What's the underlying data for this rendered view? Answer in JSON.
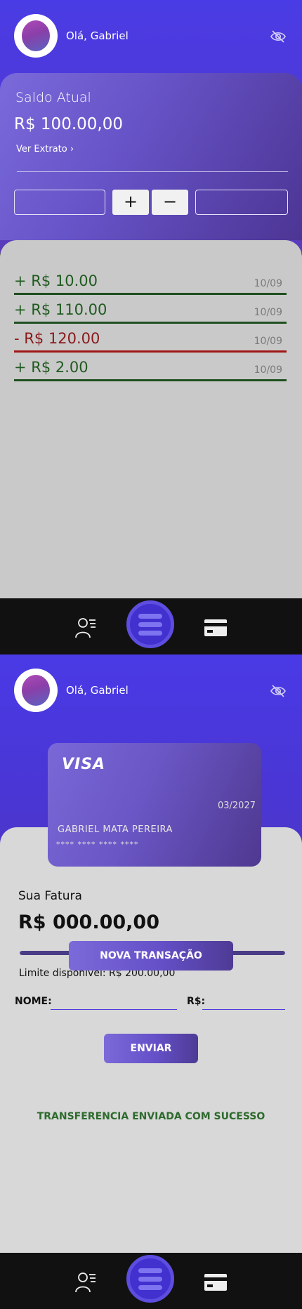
{
  "header": {
    "greeting": "Olá, Gabriel"
  },
  "balance": {
    "label": "Saldo Atual",
    "value": "R$ 100.00,00",
    "statement_link": "Ver Extrato ›",
    "plus_label": "+",
    "minus_label": "−"
  },
  "transactions": [
    {
      "amount": "+ R$ 10.00",
      "date": "10/09",
      "type": "credit"
    },
    {
      "amount": "+ R$ 110.00",
      "date": "10/09",
      "type": "credit"
    },
    {
      "amount": "- R$ 120.00",
      "date": "10/09",
      "type": "debit"
    },
    {
      "amount": "+ R$ 2.00",
      "date": "10/09",
      "type": "credit"
    }
  ],
  "card": {
    "brand": "VISA",
    "expiry": "03/2027",
    "holder": "GABRIEL MATA PEREIRA",
    "number": "**** **** **** ****"
  },
  "invoice": {
    "label": "Sua Fatura",
    "value": "R$ 000.00,00",
    "limit": "Limite disponível: R$ 200.00,00",
    "progress": 1.0
  },
  "transfer": {
    "new_button": "NOVA TRANSAÇÃO",
    "name_label": "NOME:",
    "amount_label": "R$:",
    "send_button": "ENVIAR",
    "status": "TRANSFERENCIA ENVIADA COM SUCESSO"
  },
  "colors": {
    "accent": "#4a3ce4",
    "credit": "#1f5a1f",
    "debit": "#8a1a1a",
    "success": "#2e6a2e"
  },
  "icons": [
    "eye-off-icon",
    "user-list-icon",
    "menu-icon",
    "credit-card-icon",
    "chevron-right-icon"
  ]
}
